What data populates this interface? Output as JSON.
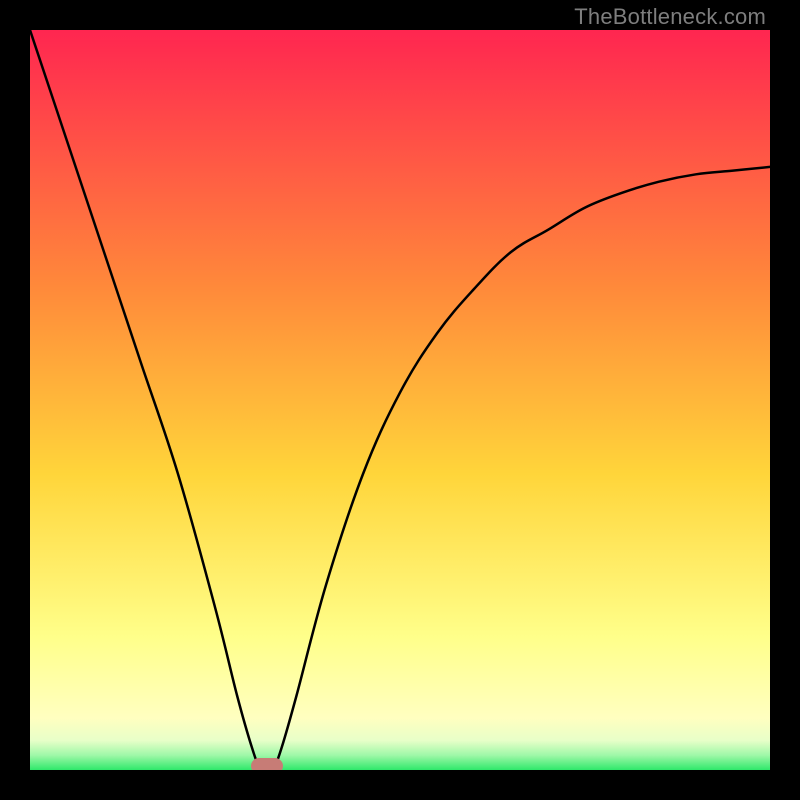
{
  "watermark": "TheBottleneck.com",
  "colors": {
    "bg": "#000000",
    "grad_top": "#ff2650",
    "grad_mid1": "#ff8a3a",
    "grad_mid2": "#ffd53a",
    "grad_low": "#ffff8a",
    "grad_pale": "#ffffc0",
    "grad_green": "#2fe86b",
    "curve": "#000000",
    "marker": "#c77c76"
  },
  "chart_data": {
    "type": "line",
    "title": "",
    "xlabel": "",
    "ylabel": "",
    "xlim": [
      0,
      100
    ],
    "ylim": [
      0,
      100
    ],
    "series": [
      {
        "name": "bottleneck-curve",
        "x": [
          0,
          5,
          10,
          15,
          20,
          25,
          28,
          30,
          31,
          32,
          33,
          34,
          36,
          40,
          45,
          50,
          55,
          60,
          65,
          70,
          75,
          80,
          85,
          90,
          95,
          100
        ],
        "values": [
          100,
          85,
          70,
          55,
          40,
          22,
          10,
          3,
          0.5,
          0,
          0.5,
          3,
          10,
          25,
          40,
          51,
          59,
          65,
          70,
          73,
          76,
          78,
          79.5,
          80.5,
          81,
          81.5
        ]
      }
    ],
    "marker": {
      "x": 32,
      "y": 0
    },
    "gradient_stops": [
      {
        "pct": 0,
        "color": "#ff2650"
      },
      {
        "pct": 35,
        "color": "#ff8a3a"
      },
      {
        "pct": 60,
        "color": "#ffd53a"
      },
      {
        "pct": 82,
        "color": "#ffff8a"
      },
      {
        "pct": 93,
        "color": "#ffffc0"
      },
      {
        "pct": 96,
        "color": "#e8ffc8"
      },
      {
        "pct": 98,
        "color": "#9ff8a8"
      },
      {
        "pct": 100,
        "color": "#2fe86b"
      }
    ]
  }
}
